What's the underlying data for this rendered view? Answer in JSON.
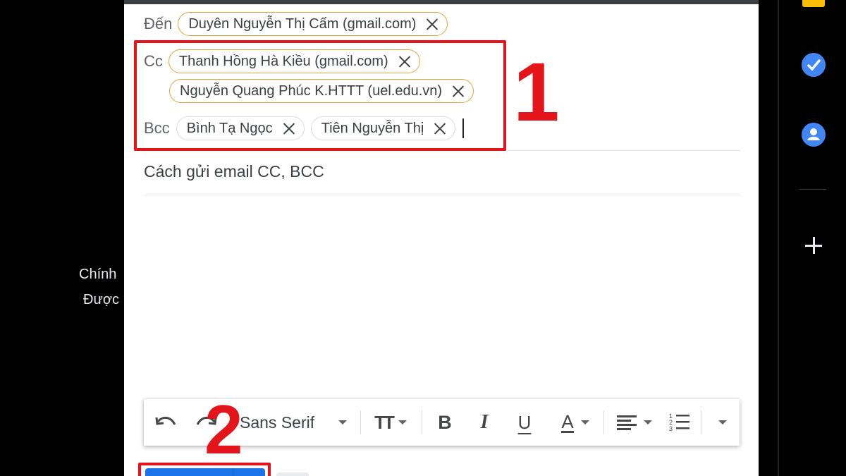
{
  "background": {
    "nav_label_1": "Chính",
    "nav_label_2": "Được"
  },
  "compose": {
    "to_label": "Đến",
    "to_recipients": [
      {
        "name": "Duyên Nguyễn Thị Cấm (gmail.com)"
      }
    ],
    "cc_label": "Cc",
    "cc_recipients": [
      {
        "name": "Thanh Hồng Hà Kiều (gmail.com)"
      },
      {
        "name": "Nguyễn Quang Phúc K.HTTT (uel.edu.vn)"
      }
    ],
    "bcc_label": "Bcc",
    "bcc_recipients": [
      {
        "name": "Bình Tạ Ngọc"
      },
      {
        "name": "Tiên Nguyễn Thị"
      }
    ],
    "subject": "Cách gửi email CC, BCC"
  },
  "annotations": {
    "step_1": "1",
    "step_2": "2"
  },
  "toolbar": {
    "font_name": "Sans Serif",
    "icons": [
      "undo-icon",
      "redo-icon",
      "font-dropdown-icon",
      "text-size-icon",
      "bold-icon",
      "italic-icon",
      "underline-icon",
      "text-color-icon",
      "align-icon",
      "numbered-list-icon",
      "more-options-icon"
    ],
    "bold_glyph": "B",
    "italic_glyph": "I",
    "underline_glyph": "U",
    "color_glyph": "A"
  },
  "side_panel": {
    "icons": [
      "keep-icon",
      "tasks-icon",
      "contacts-icon",
      "add-icon"
    ],
    "colors": {
      "keep": "#fbbc04",
      "tasks": "#4285f4",
      "contacts": "#4285f4"
    }
  },
  "colors": {
    "annotation": "#e3141a",
    "chip_highlight": "#e8a33a",
    "send_button": "#1a73e8"
  }
}
